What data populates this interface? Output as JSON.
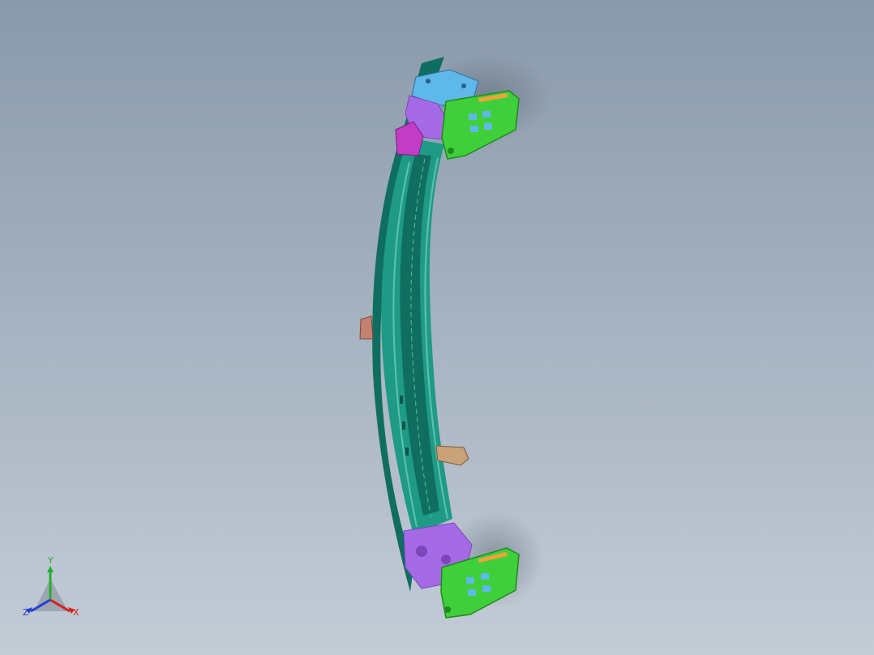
{
  "viewport": {
    "background_top": "#8a9aab",
    "background_bottom": "#c4ccd6"
  },
  "model": {
    "colors": {
      "beam_main": "#1f9a86",
      "beam_dark": "#0f6e5f",
      "beam_light": "#5cc2ad",
      "bracket_green": "#3fcf3a",
      "bracket_dark": "#1f8a1e",
      "plate_violet": "#a56be6",
      "plate_violet_dark": "#7a46b8",
      "top_blue": "#5fb8ea",
      "magenta": "#c23cc4",
      "tab_copper": "#c48070",
      "tab_tan": "#c9a27a"
    }
  },
  "triad": {
    "x_label": "X",
    "y_label": "Y",
    "z_label": "Z",
    "x_color": "#d42020",
    "y_color": "#20b030",
    "z_color": "#2040d0"
  }
}
